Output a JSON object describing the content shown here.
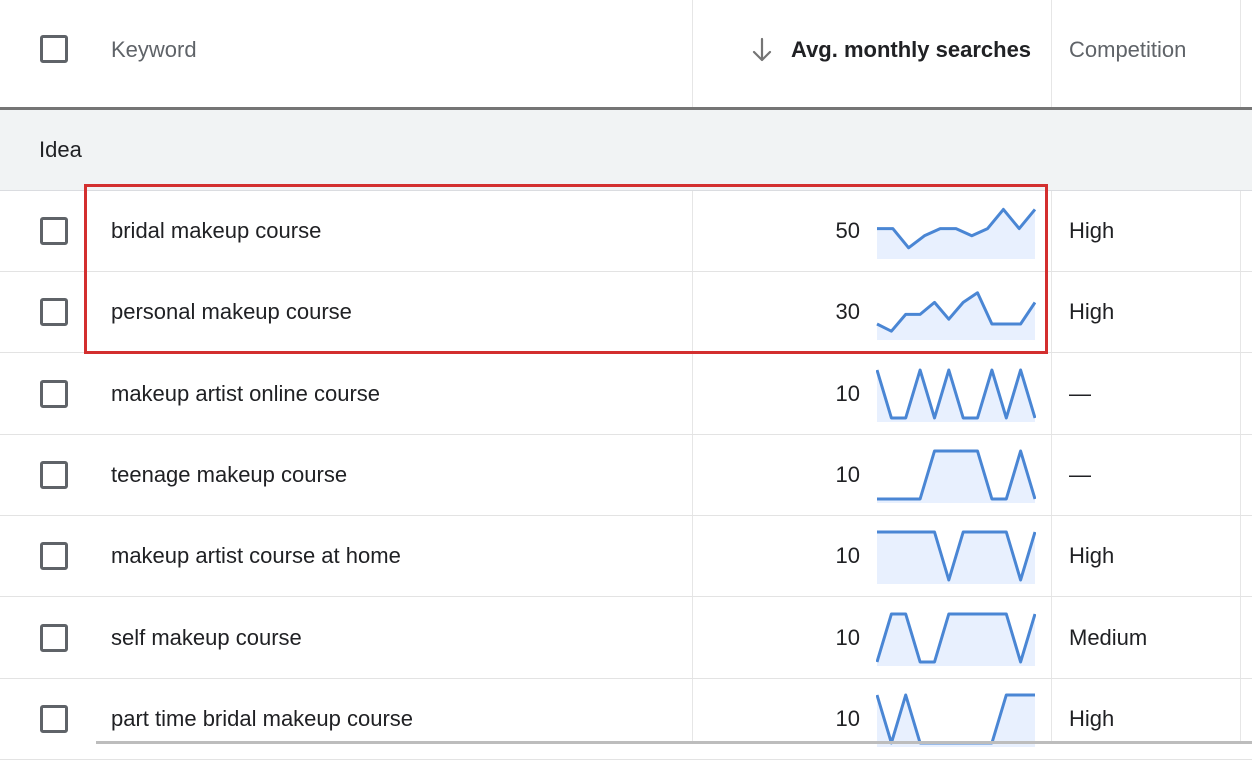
{
  "header": {
    "keyword_label": "Keyword",
    "searches_label": "Avg. monthly searches",
    "competition_label": "Competition",
    "sort_icon": "arrow-down-icon"
  },
  "group": {
    "label": "Idea"
  },
  "rows": [
    {
      "keyword": "bridal makeup course",
      "searches": "50",
      "competition": "High",
      "trend": [
        0.55,
        0.55,
        0.15,
        0.4,
        0.55,
        0.55,
        0.4,
        0.55,
        0.95,
        0.55,
        0.95
      ]
    },
    {
      "keyword": "personal makeup course",
      "searches": "30",
      "competition": "High",
      "trend": [
        0.25,
        0.1,
        0.45,
        0.45,
        0.7,
        0.35,
        0.7,
        0.9,
        0.25,
        0.25,
        0.25,
        0.7
      ]
    },
    {
      "keyword": "makeup artist online course",
      "searches": "10",
      "competition": "—",
      "trend": [
        1,
        0,
        0,
        1,
        0,
        1,
        0,
        0,
        1,
        0,
        1,
        0
      ]
    },
    {
      "keyword": "teenage makeup course",
      "searches": "10",
      "competition": "—",
      "trend": [
        0,
        0,
        0,
        0,
        1,
        1,
        1,
        1,
        0,
        0,
        1,
        0
      ]
    },
    {
      "keyword": "makeup artist course at home",
      "searches": "10",
      "competition": "High",
      "trend": [
        1,
        1,
        1,
        1,
        1,
        0,
        1,
        1,
        1,
        1,
        0,
        1
      ]
    },
    {
      "keyword": "self makeup course",
      "searches": "10",
      "competition": "Medium",
      "trend": [
        0,
        1,
        1,
        0,
        0,
        1,
        1,
        1,
        1,
        1,
        0,
        1
      ]
    },
    {
      "keyword": "part time bridal makeup course",
      "searches": "10",
      "competition": "High",
      "trend": [
        1,
        0,
        1,
        0,
        0,
        0,
        0,
        0,
        0,
        1,
        1,
        1
      ]
    }
  ],
  "colors": {
    "sparkline_stroke": "#4a86d4",
    "sparkline_fill": "#e8f0fe",
    "highlight_border": "#d32f2f",
    "group_background": "#f1f3f4"
  }
}
